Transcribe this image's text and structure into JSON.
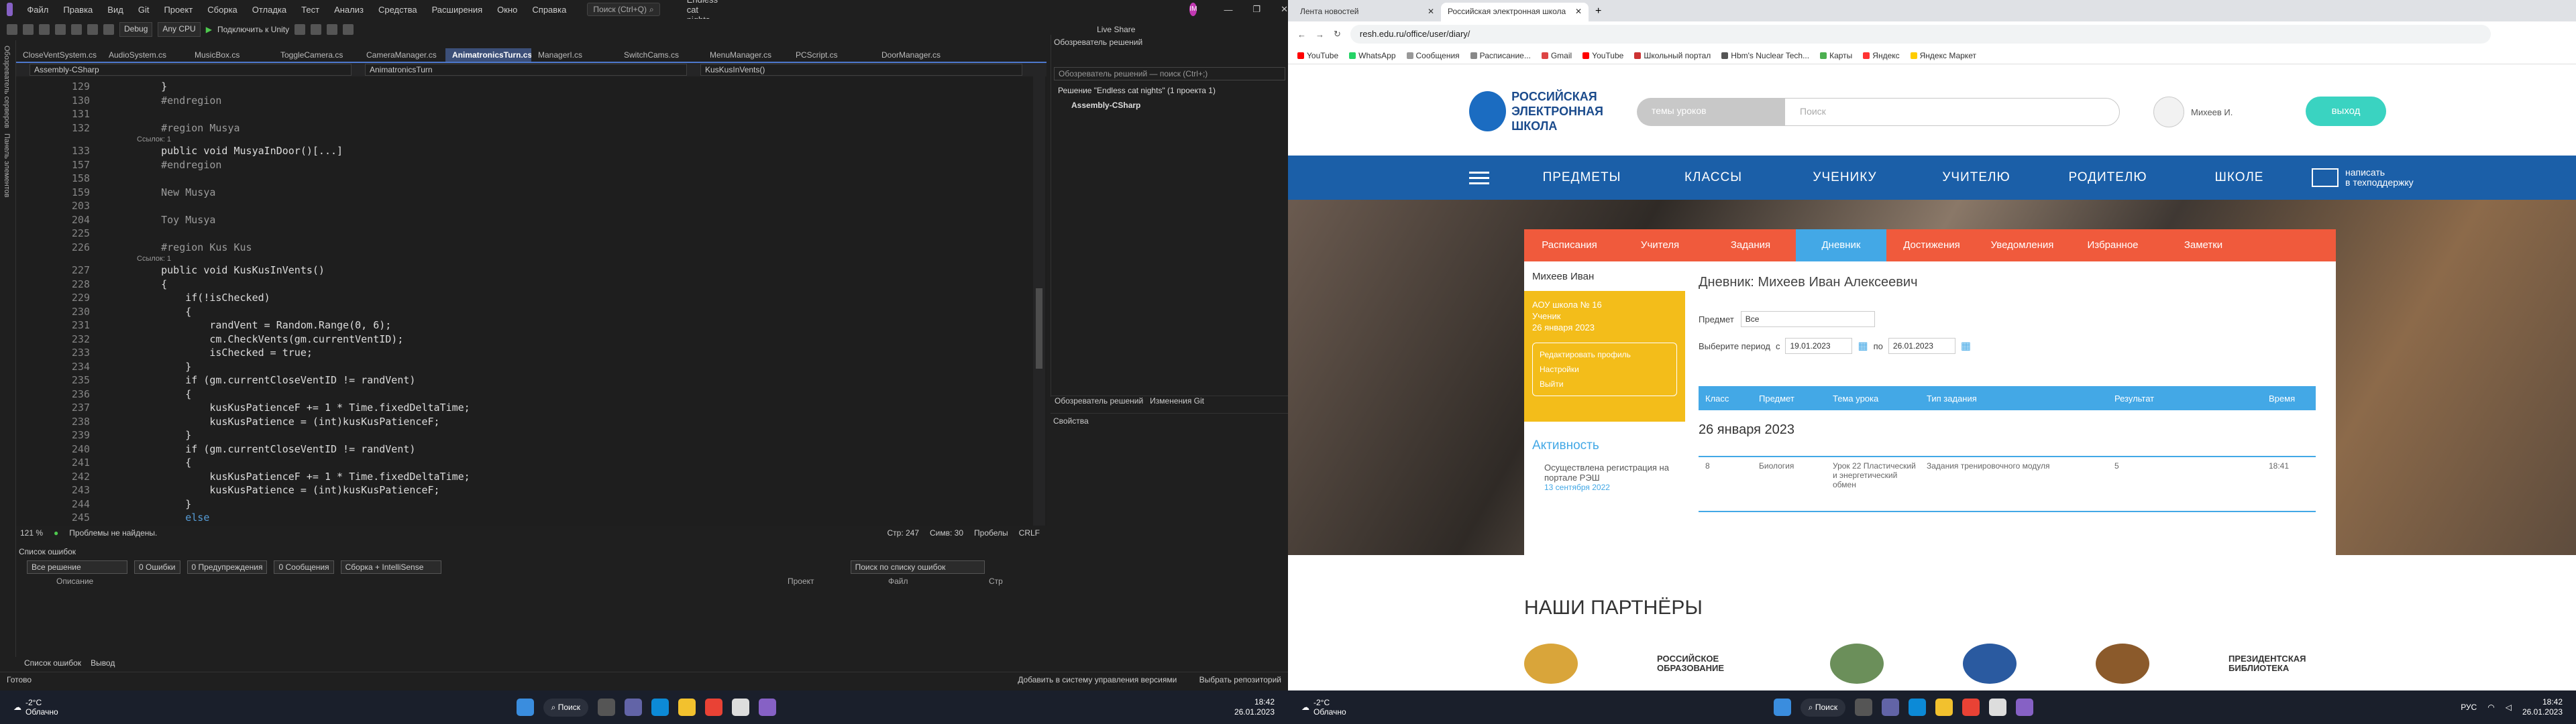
{
  "vs": {
    "menu": [
      "Файл",
      "Правка",
      "Вид",
      "Git",
      "Проект",
      "Сборка",
      "Отладка",
      "Тест",
      "Анализ",
      "Средства",
      "Расширения",
      "Окно",
      "Справка"
    ],
    "search_placeholder": "Поиск (Ctrl+Q)",
    "solution_title": "Endless cat nights",
    "avatar_initials": "IM",
    "live_share": "Live Share",
    "toolbar": {
      "config": "Debug",
      "platform": "Any CPU",
      "run": "Подключить к Unity"
    },
    "side_strip": [
      "Обозреватель серверов",
      "Панель элементов"
    ],
    "tabs": [
      "CloseVentSystem.cs",
      "AudioSystem.cs",
      "MusicBox.cs",
      "ToggleCamera.cs",
      "CameraManager.cs",
      "AnimatronicsTurn.cs",
      "ManagerI.cs",
      "SwitchCams.cs",
      "MenuManager.cs",
      "PCScript.cs",
      "DoorManager.cs"
    ],
    "active_tab_index": 5,
    "nav": {
      "project": "Assembly-CSharp",
      "class": "AnimatronicsTurn",
      "member": "KusKusInVents()"
    },
    "code": [
      {
        "n": "129",
        "t": "    }"
      },
      {
        "n": "130",
        "t": "    #endregion",
        "c": "reg"
      },
      {
        "n": "131",
        "t": ""
      },
      {
        "n": "132",
        "t": "    #region Musya",
        "c": "reg"
      },
      {
        "n": "",
        "t": "Ссылок: 1",
        "hint": true
      },
      {
        "n": "133",
        "t": "    public void MusyaInDoor()[...]",
        "c": "pub"
      },
      {
        "n": "157",
        "t": "    #endregion",
        "c": "reg"
      },
      {
        "n": "158",
        "t": ""
      },
      {
        "n": "159",
        "t": "    New Musya",
        "c": "reg"
      },
      {
        "n": "203",
        "t": ""
      },
      {
        "n": "204",
        "t": "    Toy Musya",
        "c": "reg"
      },
      {
        "n": "225",
        "t": ""
      },
      {
        "n": "226",
        "t": "    #region Kus Kus",
        "c": "reg"
      },
      {
        "n": "",
        "t": "Ссылок: 1",
        "hint": true
      },
      {
        "n": "227",
        "t": "    public void KusKusInVents()",
        "c": "pub"
      },
      {
        "n": "228",
        "t": "    {"
      },
      {
        "n": "229",
        "t": "        if(!isChecked)"
      },
      {
        "n": "230",
        "t": "        {"
      },
      {
        "n": "231",
        "t": "            randVent = Random.Range(0, 6);"
      },
      {
        "n": "232",
        "t": "            cm.CheckVents(gm.currentVentID);"
      },
      {
        "n": "233",
        "t": "            isChecked = true;"
      },
      {
        "n": "234",
        "t": "        }"
      },
      {
        "n": "235",
        "t": "        if (gm.currentCloseVentID != randVent)"
      },
      {
        "n": "236",
        "t": "        {"
      },
      {
        "n": "237",
        "t": "            kusKusPatienceF += 1 * Time.fixedDeltaTime;"
      },
      {
        "n": "238",
        "t": "            kusKusPatience = (int)kusKusPatienceF;"
      },
      {
        "n": "239",
        "t": "        }"
      },
      {
        "n": "240",
        "t": "        if (gm.currentCloseVentID != randVent)"
      },
      {
        "n": "241",
        "t": "        {"
      },
      {
        "n": "242",
        "t": "            kusKusPatienceF += 1 * Time.fixedDeltaTime;"
      },
      {
        "n": "243",
        "t": "            kusKusPatience = (int)kusKusPatienceF;"
      },
      {
        "n": "244",
        "t": "        }"
      },
      {
        "n": "245",
        "t": "        else",
        "c": "kw"
      }
    ],
    "editor_status": {
      "zoom": "121 %",
      "problems": "Проблемы не найдены.",
      "line": "Стр: 247",
      "col": "Симв: 30",
      "spaces": "Пробелы",
      "eol": "CRLF"
    },
    "error_list": {
      "title": "Список ошибок",
      "scope": "Все решение",
      "errors": "0 Ошибки",
      "warnings": "0 Предупреждения",
      "messages": "0 Сообщения",
      "build": "Сборка + IntelliSense",
      "search": "Поиск по списку ошибок",
      "cols": [
        "Описание",
        "Проект",
        "Файл",
        "Стр"
      ]
    },
    "bottom_tabs": [
      "Список ошибок",
      "Вывод"
    ],
    "status": {
      "ready": "Готово",
      "git": "Добавить в систему управления версиями",
      "repo": "Выбрать репозиторий"
    },
    "solution_explorer": {
      "title": "Обозреватель решений",
      "search": "Обозреватель решений — поиск (Ctrl+;)",
      "solution": "Решение \"Endless cat nights\" (1 проекта 1)",
      "project": "Assembly-CSharp",
      "tabs": [
        "Обозреватель решений",
        "Изменения Git"
      ],
      "props": "Свойства"
    }
  },
  "taskbar": {
    "temp": "-2°C",
    "weather": "Облачно",
    "search": "Поиск",
    "time": "18:42",
    "date": "26.01.2023",
    "lang": "РУС"
  },
  "browser": {
    "tabs": [
      "Лента новостей",
      "Российская электронная школа"
    ],
    "url": "resh.edu.ru/office/user/diary/",
    "bookmarks": [
      "YouTube",
      "WhatsApp",
      "Сообщения",
      "Расписание...",
      "Gmail",
      "YouTube",
      "Школьный портал",
      "Hbm's Nuclear Tech...",
      "Карты",
      "Яндекс",
      "Яндекс Маркет"
    ],
    "logo": [
      "РОССИЙСКАЯ",
      "ЭЛЕКТРОННАЯ",
      "ШКОЛА"
    ],
    "themes": "темы уроков",
    "search_placeholder": "Поиск",
    "user": "Михеев И.",
    "exit": "выход",
    "nav": [
      "ПРЕДМЕТЫ",
      "КЛАССЫ",
      "УЧЕНИКУ",
      "УЧИТЕЛЮ",
      "РОДИТЕЛЮ",
      "ШКОЛЕ"
    ],
    "support": [
      "написать",
      "в техподдержку"
    ],
    "card_tabs": [
      "Расписания",
      "Учителя",
      "Задания",
      "Дневник",
      "Достижения",
      "Уведомления",
      "Избранное",
      "Заметки"
    ],
    "active_card_tab": 3,
    "left": {
      "name": "Михеев Иван",
      "school": "АОУ школа № 16",
      "role": "Ученик",
      "date": "26 января 2023",
      "links": [
        "Редактировать профиль",
        "Настройки",
        "Выйти"
      ],
      "activity": "Активность",
      "activity_item": "Осуществлена регистрация на портале РЭШ",
      "activity_date": "13 сентября 2022"
    },
    "diary": {
      "title": "Дневник: Михеев Иван Алексеевич",
      "subject_label": "Предмет",
      "subject": "Все",
      "period_label": "Выберите период",
      "from": "с",
      "from_date": "19.01.2023",
      "to": "по",
      "to_date": "26.01.2023",
      "cols": [
        "Класс",
        "Предмет",
        "Тема урока",
        "Тип задания",
        "Результат",
        "Время"
      ],
      "day": "26 января 2023",
      "row": {
        "cls": "8",
        "subject": "Биология",
        "topic": "Урок 22 Пластический и энергетический обмен",
        "type": "Задания тренировочного модуля",
        "result": "5",
        "time": "18:41"
      }
    },
    "partners_title": "НАШИ ПАРТНЁРЫ",
    "partners": [
      "РОССИЙСКОЕ ОБРАЗОВАНИЕ",
      "ПРЕЗИДЕНТСКАЯ БИБЛИОТЕКА"
    ]
  }
}
